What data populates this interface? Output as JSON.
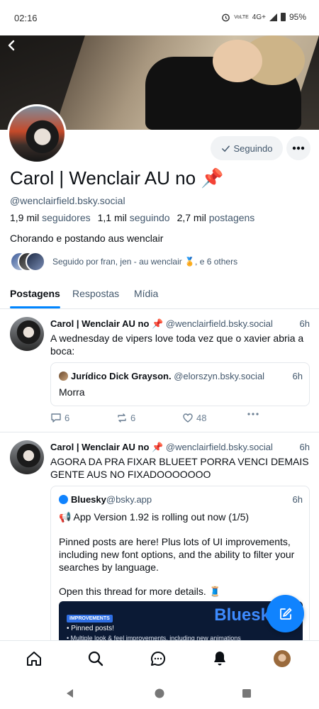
{
  "status_bar": {
    "time": "02:16",
    "network_tiny": "VoLTE",
    "network": "4G+",
    "battery": "95%"
  },
  "profile": {
    "display_name": "Carol | Wenclair AU no 📌",
    "handle": "@wenclairfield.bsky.social",
    "followers_count": "1,9 mil",
    "followers_label": "seguidores",
    "following_count": "1,1 mil",
    "following_label": "seguindo",
    "posts_count": "2,7 mil",
    "posts_label": "postagens",
    "bio": "Chorando e postando aus wenclair",
    "followed_by": "Seguido por fran, jen - au wenclair 🏅, e 6 others",
    "following_button": "Seguindo"
  },
  "tabs": [
    {
      "label": "Postagens",
      "active": true
    },
    {
      "label": "Respostas",
      "active": false
    },
    {
      "label": "Mídia",
      "active": false
    }
  ],
  "posts": [
    {
      "author": "Carol | Wenclair AU no 📌",
      "handle": "@wenclairfield.bsky.social",
      "time": "6h",
      "text": "A wednesday de vipers love toda vez que o xavier abria a boca:",
      "quote": {
        "author": "Jurídico Dick Grayson.",
        "handle": "@elorszyn.bsky.social",
        "time": "6h",
        "text": "Morra"
      },
      "replies": "6",
      "reposts": "6",
      "likes": "48"
    },
    {
      "author": "Carol | Wenclair AU no 📌",
      "handle": "@wenclairfield.bsky.social",
      "time": "6h",
      "text": "AGORA DA PRA FIXAR BLUEET PORRA VENCI DEMAIS GENTE AUS NO FIXADOOOOOOO",
      "quote": {
        "author": "Bluesky",
        "handle": "@bsky.app",
        "time": "6h",
        "line1": "📢 App Version 1.92 is rolling out now (1/5)",
        "line2": "Pinned posts are here! Plus lots of UI improvements, including new font options, and the ability to filter your searches by language.",
        "line3": "Open this thread for more details. 🧵",
        "media_pill": "IMPROVEMENTS",
        "media_title": "Bluesky 1.",
        "media_item1": "• Pinned posts!",
        "media_item2": "• Multiple look & feel improvements, including new animations"
      }
    }
  ],
  "colors": {
    "accent": "#0085ff",
    "text": "#0b0f14",
    "muted": "#42576c",
    "divider": "#e4e8ec"
  },
  "icons": [
    "back-icon",
    "check-icon",
    "more-icon",
    "reply-icon",
    "repost-icon",
    "like-icon",
    "compose-icon",
    "home-icon",
    "search-icon",
    "chat-icon",
    "bell-icon",
    "profile-avatar"
  ]
}
